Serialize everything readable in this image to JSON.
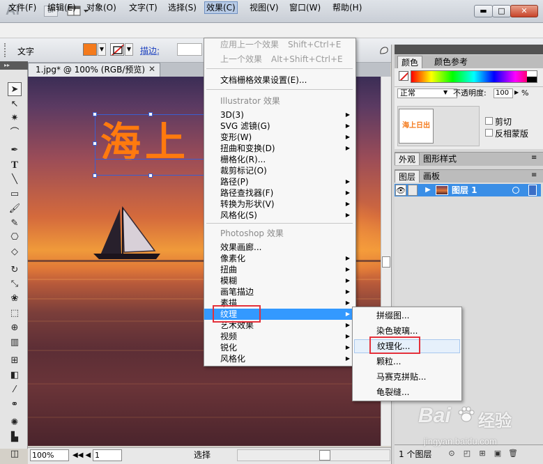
{
  "titlebar": {
    "app_logo": "Ai",
    "bridge_label": "Br",
    "window_buttons": {
      "minimize": "▬",
      "maximize": "□",
      "close": "✕"
    }
  },
  "menubar": {
    "items": [
      "文件(F)",
      "编辑(E)",
      "对象(O)",
      "文字(T)",
      "选择(S)",
      "效果(C)",
      "视图(V)",
      "窗口(W)",
      "帮助(H)"
    ]
  },
  "controlbar": {
    "tool_label": "文字",
    "stroke_label": "描边:",
    "fill_color": "#f47a1c"
  },
  "document": {
    "tab_title": "1.jpg* @ 100% (RGB/预览)",
    "close_glyph": "✕",
    "canvas_text": "海上",
    "text_color": "#ff7a0e"
  },
  "effect_menu": {
    "apply_last": {
      "label": "应用上一个效果",
      "shortcut": "Shift+Ctrl+E"
    },
    "last_effect": {
      "label": "上一个效果",
      "shortcut": "Alt+Shift+Ctrl+E"
    },
    "raster_settings": "文档栅格效果设置(E)...",
    "illustrator_header": "Illustrator 效果",
    "illustrator_items": [
      {
        "label": "3D(3)",
        "has_submenu": true
      },
      {
        "label": "SVG 滤镜(G)",
        "has_submenu": true
      },
      {
        "label": "变形(W)",
        "has_submenu": true
      },
      {
        "label": "扭曲和变换(D)",
        "has_submenu": true
      },
      {
        "label": "栅格化(R)...",
        "has_submenu": false
      },
      {
        "label": "裁剪标记(O)",
        "has_submenu": false
      },
      {
        "label": "路径(P)",
        "has_submenu": true
      },
      {
        "label": "路径查找器(F)",
        "has_submenu": true
      },
      {
        "label": "转换为形状(V)",
        "has_submenu": true
      },
      {
        "label": "风格化(S)",
        "has_submenu": true
      }
    ],
    "photoshop_header": "Photoshop 效果",
    "photoshop_items": [
      {
        "label": "效果画廊...",
        "has_submenu": false
      },
      {
        "label": "像素化",
        "has_submenu": true
      },
      {
        "label": "扭曲",
        "has_submenu": true
      },
      {
        "label": "模糊",
        "has_submenu": true
      },
      {
        "label": "画笔描边",
        "has_submenu": true
      },
      {
        "label": "素描",
        "has_submenu": true
      },
      {
        "label": "纹理",
        "has_submenu": true
      },
      {
        "label": "艺术效果",
        "has_submenu": true
      },
      {
        "label": "视频",
        "has_submenu": true
      },
      {
        "label": "锐化",
        "has_submenu": true
      },
      {
        "label": "风格化",
        "has_submenu": true
      }
    ],
    "highlighted_item": "纹理"
  },
  "texture_submenu": {
    "items": [
      "拼缀图...",
      "染色玻璃...",
      "纹理化...",
      "颗粒...",
      "马赛克拼贴...",
      "龟裂缝..."
    ],
    "hovered_item": "纹理化..."
  },
  "color_panel": {
    "tabs": [
      "颜色",
      "颜色参考"
    ],
    "active_tab": "颜色"
  },
  "transparency_panel": {
    "blend_mode": "正常",
    "opacity_label": "不透明度:",
    "opacity_value": "100",
    "pct": "%",
    "thumb_text": "海上日出",
    "clip_label": "剪切",
    "invert_label": "反相蒙版"
  },
  "appearance_tabs": [
    "外观",
    "图形样式"
  ],
  "layers_panel": {
    "tabs": [
      "图层",
      "画板"
    ],
    "layer_name": "图层 1",
    "layer_count": "1 个图层"
  },
  "statusbar": {
    "zoom": "100%",
    "page": "1",
    "nav_glyphs": "◀◀ ◀",
    "status_text": "选择"
  },
  "watermark": {
    "brand": "Bai",
    "brand_suffix": "经验",
    "url": "jingyan.baidu.com"
  }
}
